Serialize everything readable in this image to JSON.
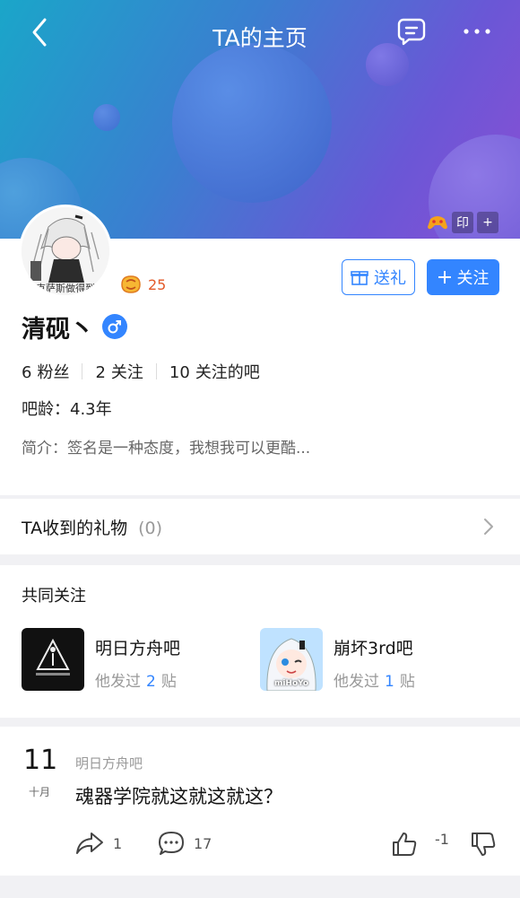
{
  "nav": {
    "title": "TA的主页"
  },
  "banner_badges": {
    "seal": "印",
    "add": "+"
  },
  "profile": {
    "avatar_caption": "克萨斯做得到",
    "level": "25",
    "gift_button": "送礼",
    "follow_button": "关注",
    "username": "清砚丶",
    "gender": "male",
    "stats": {
      "fans_num": "6",
      "fans_label": "粉丝",
      "following_num": "2",
      "following_label": "关注",
      "bars_num": "10",
      "bars_label": "关注的吧"
    },
    "bar_age": "吧龄：4.3年",
    "intro": "简介：签名是一种态度，我想我可以更酷..."
  },
  "gifts": {
    "label": "TA收到的礼物",
    "count": "(0)"
  },
  "common_follow": {
    "title": "共同关注",
    "forums": [
      {
        "name": "明日方舟吧",
        "posted_prefix": "他发过",
        "count": "2",
        "posted_suffix": "贴"
      },
      {
        "name": "崩坏3rd吧",
        "posted_prefix": "他发过",
        "count": "1",
        "posted_suffix": "贴"
      }
    ],
    "forum_badge_text": [
      "",
      "miHoYo"
    ]
  },
  "post": {
    "day": "11",
    "month": "十月",
    "forum": "明日方舟吧",
    "title": "魂器学院就这就这就这？",
    "share_count": "1",
    "comment_count": "17",
    "vote_count": "-1"
  },
  "colors": {
    "accent": "#3385ff",
    "level": "#e35a2a"
  }
}
